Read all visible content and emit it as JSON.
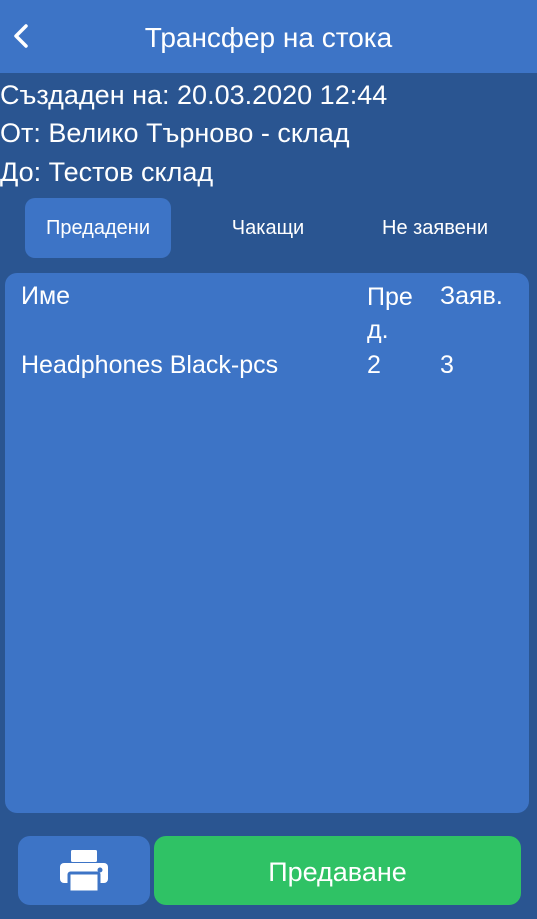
{
  "header": {
    "title": "Трансфер на стока",
    "back_icon": "chevron-left-icon"
  },
  "info": {
    "created": "Създаден на: 20.03.2020 12:44",
    "from": "От: Велико Търново - склад",
    "to": "До: Тестов склад"
  },
  "tabs": [
    {
      "label": "Предадени",
      "active": true
    },
    {
      "label": "Чакащи",
      "active": false
    },
    {
      "label": "Не заявени",
      "active": false
    }
  ],
  "table": {
    "columns": {
      "name": "Име",
      "sent": "Пред.",
      "requested": "Заяв."
    },
    "rows": [
      {
        "name": "Headphones Black-pcs",
        "sent": "2",
        "requested": "3"
      }
    ]
  },
  "footer": {
    "print_icon": "printer-icon",
    "submit_label": "Предаване"
  },
  "colors": {
    "background": "#2a5591",
    "header": "#3d74c6",
    "panel": "#3d74c6",
    "submit": "#2fc265",
    "text": "#ffffff"
  }
}
